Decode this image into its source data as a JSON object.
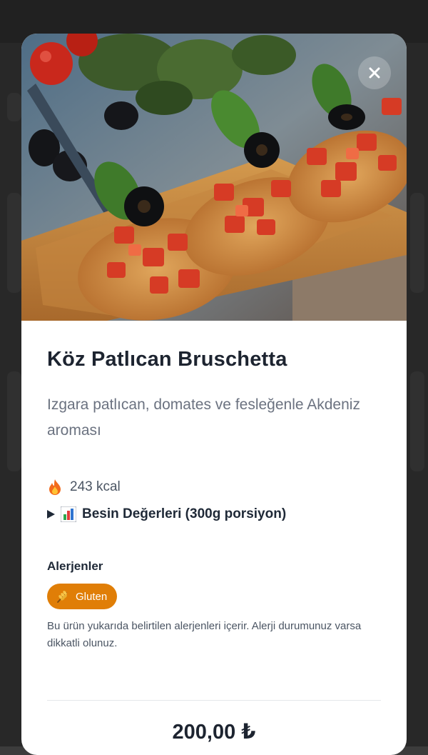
{
  "product": {
    "title": "Köz Patlıcan Bruschetta",
    "description": "Izgara patlıcan, domates ve fesleğenle Akdeniz aroması",
    "calories": "243 kcal",
    "nutrition_toggle": "Besin Değerleri (300g porsiyon)",
    "price": "200,00 ₺"
  },
  "allergens": {
    "heading": "Alerjenler",
    "items": [
      "Gluten"
    ],
    "note": "Bu ürün yukarıda belirtilen alerjenleri içerir. Alerji durumunuz varsa dikkatli olunuz."
  },
  "icons": {
    "close": "close-icon",
    "calories": "flame-icon",
    "nutrition_expand": "triangle-right-icon",
    "nutrition": "bar-chart-icon",
    "allergen": "wheat-icon"
  },
  "colors": {
    "accent": "#e07e07",
    "title": "#1d2430",
    "muted": "#6b7280"
  }
}
